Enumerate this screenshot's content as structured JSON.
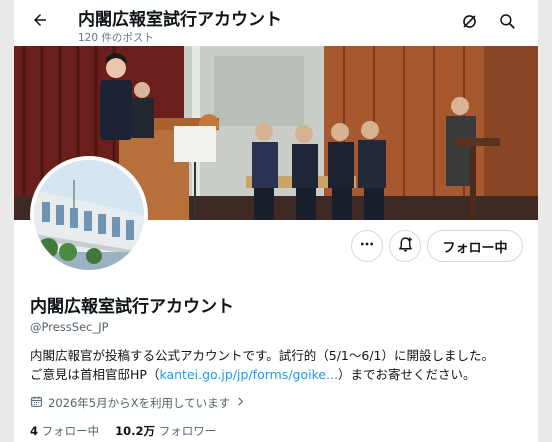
{
  "header": {
    "title": "内閣広報室試行アカウント",
    "post_count": "120 件のポスト"
  },
  "icons": {
    "back": "arrow-left-icon",
    "grok": "grok-icon",
    "search": "search-icon",
    "more": "more-dots-icon",
    "notify": "bell-plus-icon",
    "calendar": "calendar-icon",
    "chevron": "chevron-right-icon"
  },
  "actions": {
    "follow_label": "フォロー中"
  },
  "profile": {
    "name": "内閣広報室試行アカウント",
    "handle": "@PressSec_JP",
    "bio_line1": "内閣広報官が投稿する公式アカウントです。試行的（5/1～6/1）に開設しました。",
    "bio_line2_prefix": "ご意見は首相官邸HP（",
    "bio_link": "kantei.go.jp/jp/forms/goike...",
    "bio_line2_suffix": "）までお寄せください。",
    "joined": "2026年5月からXを利用しています"
  },
  "stats": {
    "following_count": "4",
    "following_label": "フォロー中",
    "followers_count": "10.2万",
    "followers_label": "フォロワー"
  },
  "colors": {
    "accent": "#1d9bf0",
    "secondary_text": "#536471"
  }
}
